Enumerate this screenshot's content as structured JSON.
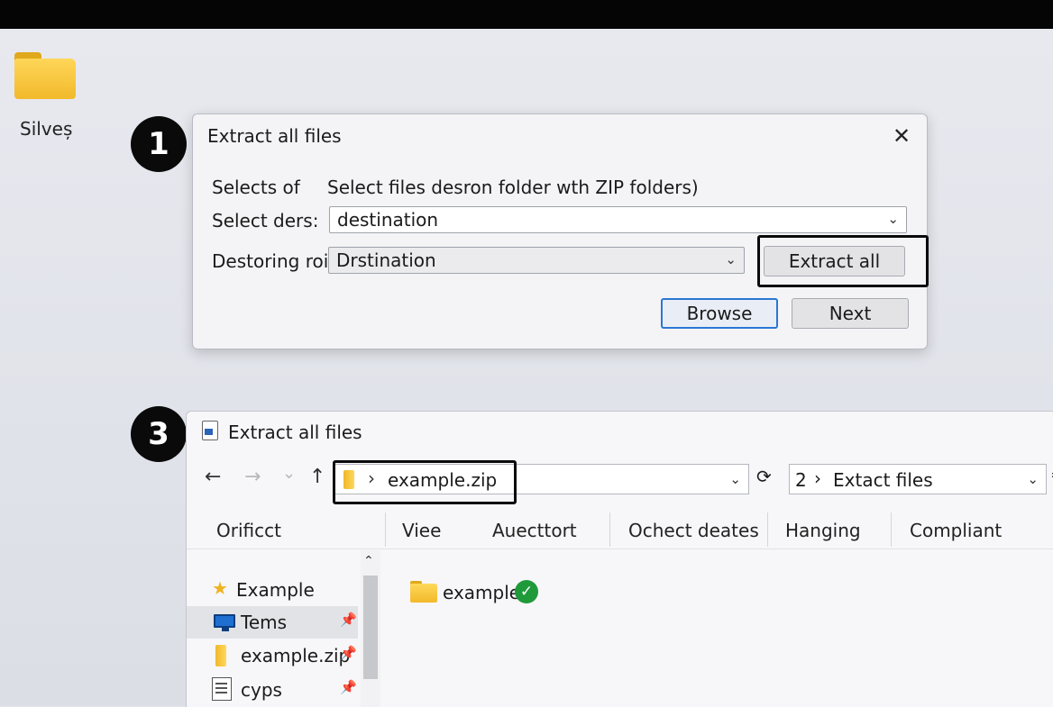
{
  "desktop": {
    "folder_label": "Silveș"
  },
  "steps": {
    "first": "1",
    "second": "3"
  },
  "dialog": {
    "title": "Extract all files",
    "close_glyph": "✕",
    "row1": {
      "label": "Selects of",
      "value": "Select files desron folder wth ZIP folders)"
    },
    "row2": {
      "label": "Select ders:",
      "value": "destination"
    },
    "row3": {
      "label": "Destoring rois:",
      "value": "Drstination"
    },
    "extract_all_label": "Extract all",
    "browse_label": "Browse",
    "next_label": "Next"
  },
  "explorer": {
    "title": "Extract all files",
    "nav": {
      "back": "←",
      "forward": "→",
      "recent": "⌄",
      "up": "↑"
    },
    "address": {
      "separator": "›",
      "path": "example.zip"
    },
    "refresh_glyph": "⟳",
    "search": {
      "number": "2",
      "separator": "›",
      "text": "Extact files"
    },
    "columns": [
      "Orificct",
      "Viee",
      "Auecttort",
      "Ochect deates",
      "Hanging",
      "Compliant"
    ],
    "nav_items": [
      {
        "label": "Example",
        "icon": "star-icon",
        "pinned": false
      },
      {
        "label": "Tems",
        "icon": "monitor-icon",
        "pinned": true
      },
      {
        "label": "example.zip",
        "icon": "zip-folder-icon",
        "pinned": true
      },
      {
        "label": "cyps",
        "icon": "document-icon",
        "pinned": true
      }
    ],
    "pin_glyph": "📌",
    "files": [
      {
        "label": "example",
        "status": "extracted",
        "check_glyph": "✓"
      }
    ]
  },
  "colors": {
    "highlight": "#0a0a0a",
    "primary_border": "#2a77d4",
    "check": "#1f9a3a",
    "folder": "#f2b92b"
  }
}
